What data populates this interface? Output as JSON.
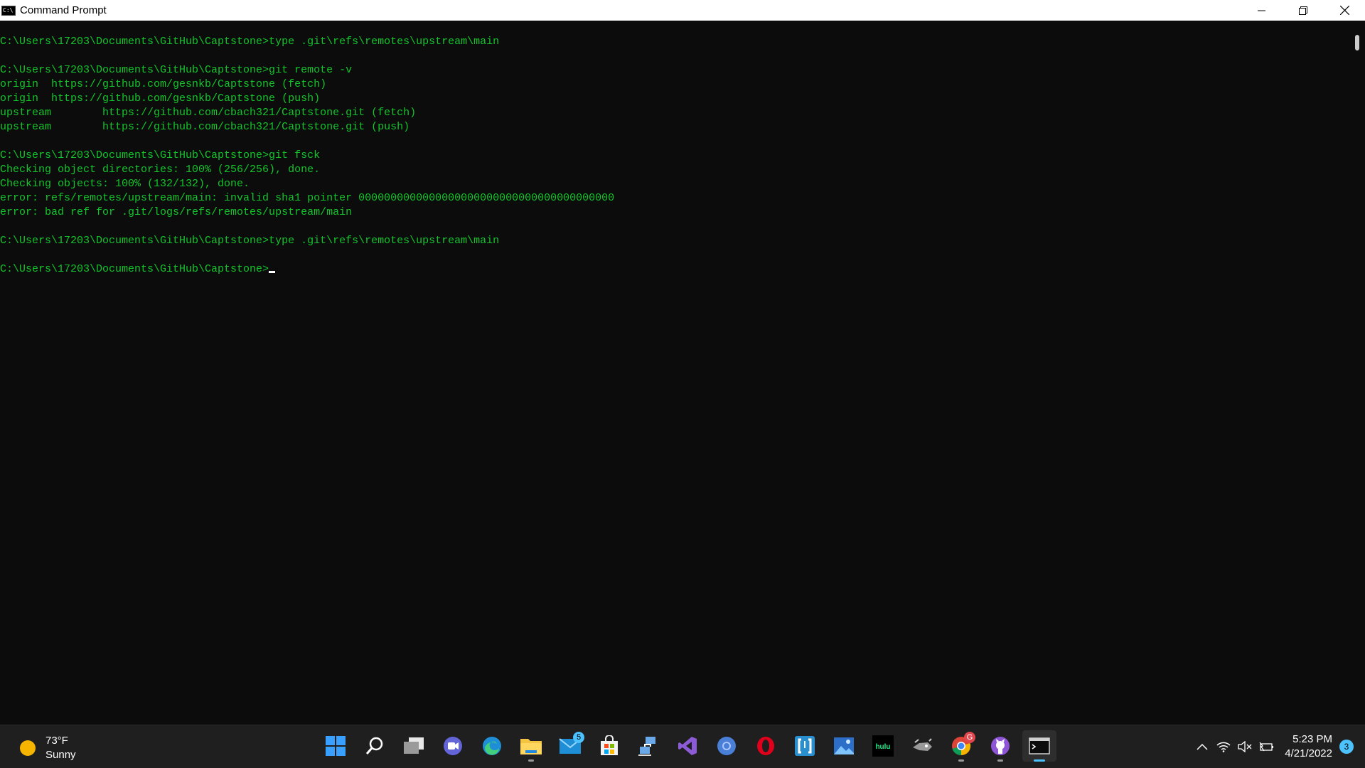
{
  "window": {
    "title": "Command Prompt",
    "icon_label": "C:\\"
  },
  "console": {
    "lines": [
      "C:\\Users\\17203\\Documents\\GitHub\\Captstone>type .git\\refs\\remotes\\upstream\\main",
      "",
      "C:\\Users\\17203\\Documents\\GitHub\\Captstone>git remote -v",
      "origin  https://github.com/gesnkb/Captstone (fetch)",
      "origin  https://github.com/gesnkb/Captstone (push)",
      "upstream        https://github.com/cbach321/Captstone.git (fetch)",
      "upstream        https://github.com/cbach321/Captstone.git (push)",
      "",
      "C:\\Users\\17203\\Documents\\GitHub\\Captstone>git fsck",
      "Checking object directories: 100% (256/256), done.",
      "Checking objects: 100% (132/132), done.",
      "error: refs/remotes/upstream/main: invalid sha1 pointer 0000000000000000000000000000000000000000",
      "error: bad ref for .git/logs/refs/remotes/upstream/main",
      "",
      "C:\\Users\\17203\\Documents\\GitHub\\Captstone>type .git\\refs\\remotes\\upstream\\main",
      ""
    ],
    "prompt": "C:\\Users\\17203\\Documents\\GitHub\\Captstone>"
  },
  "taskbar": {
    "weather": {
      "temp": "73°F",
      "condition": "Sunny"
    },
    "icons": [
      {
        "name": "start-icon"
      },
      {
        "name": "search-icon"
      },
      {
        "name": "task-view-icon"
      },
      {
        "name": "teams-chat-icon"
      },
      {
        "name": "edge-icon"
      },
      {
        "name": "file-explorer-icon"
      },
      {
        "name": "mail-icon",
        "badge": "5"
      },
      {
        "name": "microsoft-store-icon"
      },
      {
        "name": "network-tool-icon"
      },
      {
        "name": "visual-studio-icon"
      },
      {
        "name": "chromium-icon"
      },
      {
        "name": "opera-icon"
      },
      {
        "name": "bracket-app-icon"
      },
      {
        "name": "photos-icon"
      },
      {
        "name": "hulu-icon",
        "label": "hulu"
      },
      {
        "name": "game-icon"
      },
      {
        "name": "chrome-icon",
        "badge": "G"
      },
      {
        "name": "github-desktop-icon"
      },
      {
        "name": "command-prompt-icon"
      }
    ],
    "clock": {
      "time": "5:23 PM",
      "date": "4/21/2022"
    },
    "notifications": "3"
  },
  "colors": {
    "console_bg": "#0c0c0c",
    "console_text": "#13c52b",
    "taskbar_bg": "#1f1f1f",
    "accent": "#4cc2ff"
  }
}
